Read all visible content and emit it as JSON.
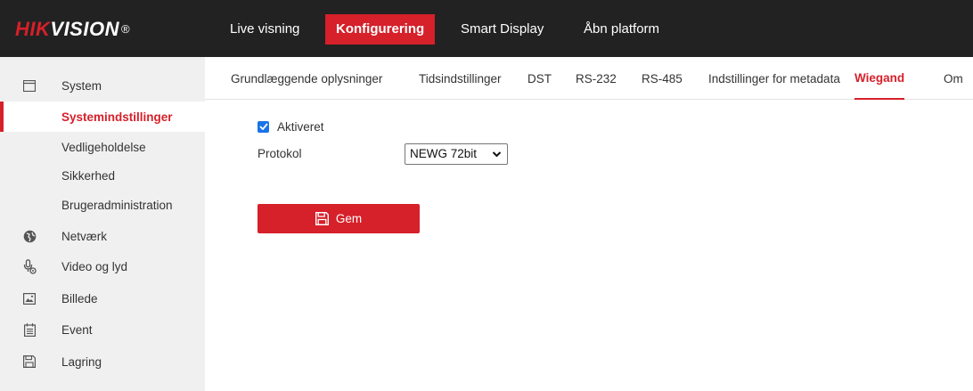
{
  "brand": {
    "logo_red": "HIK",
    "logo_white": "VISION",
    "logo_mark": "®",
    "accent": "#d6202a",
    "topbar_bg": "#222222"
  },
  "topnav": {
    "items": [
      {
        "label": "Live visning",
        "active": false
      },
      {
        "label": "Konfigurering",
        "active": true
      },
      {
        "label": "Smart Display",
        "active": false
      },
      {
        "label": "Åbn platform",
        "active": false
      }
    ]
  },
  "sidebar": {
    "items": [
      {
        "label": "System",
        "icon": "monitor-icon"
      },
      {
        "label": "Systemindstillinger",
        "active": true
      },
      {
        "label": "Vedligeholdelse"
      },
      {
        "label": "Sikkerhed"
      },
      {
        "label": "Brugeradministration"
      },
      {
        "label": "Netværk",
        "icon": "globe-icon"
      },
      {
        "label": "Video og lyd",
        "icon": "microphone-icon"
      },
      {
        "label": "Billede",
        "icon": "image-icon"
      },
      {
        "label": "Event",
        "icon": "calendar-icon"
      },
      {
        "label": "Lagring",
        "icon": "save-icon"
      }
    ]
  },
  "tabs": {
    "items": [
      {
        "label": "Grundlæggende oplysninger"
      },
      {
        "label": "Tidsindstillinger"
      },
      {
        "label": "DST"
      },
      {
        "label": "RS-232"
      },
      {
        "label": "RS-485"
      },
      {
        "label": "Indstillinger for metadata"
      },
      {
        "label": "Wiegand",
        "active": true
      },
      {
        "label": "Om"
      }
    ]
  },
  "form": {
    "enabled_label": "Aktiveret",
    "enabled": true,
    "protocol_label": "Protokol",
    "protocol_value": "NEWG 72bit",
    "save_label": "Gem"
  }
}
